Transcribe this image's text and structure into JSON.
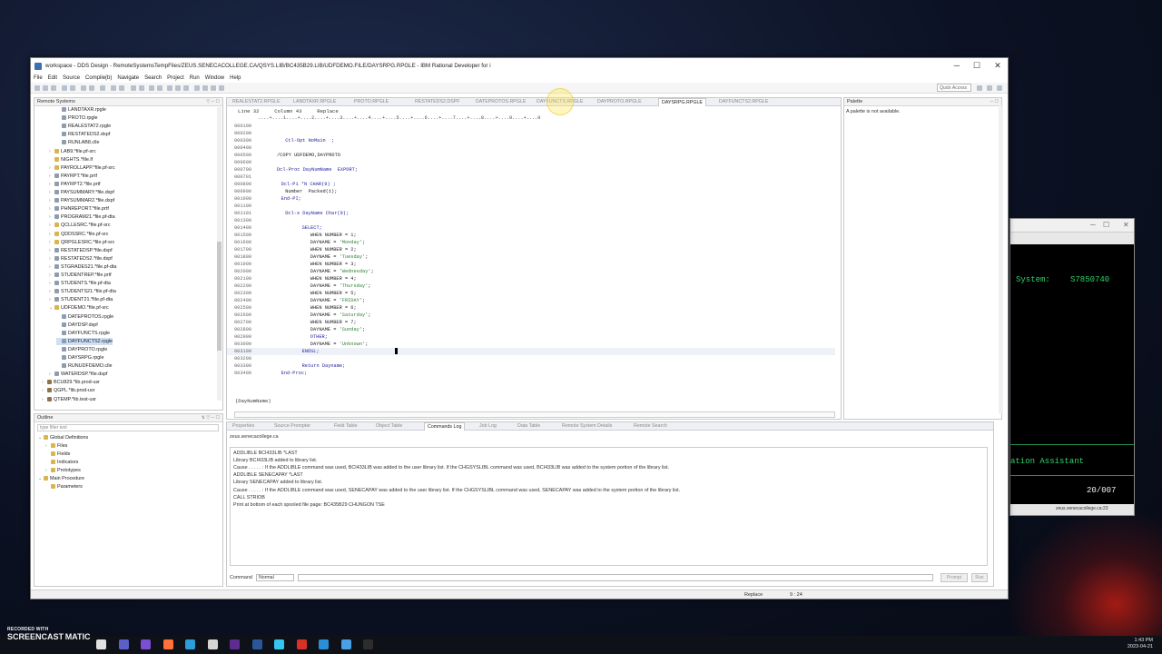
{
  "window": {
    "title": "workspace - DDS Design - RemoteSystemsTempFiles/ZEUS.SENECACOLLEGE.CA/QSYS.LIB/BC435B29.LIB/UDFDEMO.FILE/DAYSRPG.RPGLE - IBM Rational Developer for i",
    "min": "─",
    "max": "☐",
    "close": "✕"
  },
  "menu": [
    "File",
    "Edit",
    "Source",
    "Compile(b)",
    "Navigate",
    "Search",
    "Project",
    "Run",
    "Window",
    "Help"
  ],
  "quick_access": "Quick Access",
  "remote_systems": {
    "title": "Remote Systems",
    "items": [
      {
        "label": "LANDTAXR.rpgle",
        "indent": 3,
        "kind": "file"
      },
      {
        "label": "PROTO.rpgle",
        "indent": 3,
        "kind": "file"
      },
      {
        "label": "REALESTAT2.rpgle",
        "indent": 3,
        "kind": "file"
      },
      {
        "label": "RESTATEDS2.dspf",
        "indent": 3,
        "kind": "file"
      },
      {
        "label": "RUNLAB8.clle",
        "indent": 3,
        "kind": "file"
      },
      {
        "label": "LAB9.*file.pf-src",
        "indent": 2,
        "kind": "folder",
        "tw": "›"
      },
      {
        "label": "NIGHTS.*file.lf",
        "indent": 2,
        "kind": "folder",
        "tw": ""
      },
      {
        "label": "PAYROLLAPP.*file.pf-src",
        "indent": 2,
        "kind": "folder",
        "tw": "›"
      },
      {
        "label": "PAYRPT.*file.prtf",
        "indent": 2,
        "kind": "file",
        "tw": "›"
      },
      {
        "label": "PAYRPT2.*file.prtf",
        "indent": 2,
        "kind": "file",
        "tw": "›"
      },
      {
        "label": "PAYSUMMARY.*file.dspf",
        "indent": 2,
        "kind": "file",
        "tw": "›"
      },
      {
        "label": "PAYSUMMAR2.*file.dspf",
        "indent": 2,
        "kind": "file",
        "tw": "›"
      },
      {
        "label": "PHNREPORT.*file.prtf",
        "indent": 2,
        "kind": "file",
        "tw": "›"
      },
      {
        "label": "PROGRAM21.*file.pf-dta",
        "indent": 2,
        "kind": "file",
        "tw": "›"
      },
      {
        "label": "QCLLESRC.*file.pf-src",
        "indent": 2,
        "kind": "folder",
        "tw": "›"
      },
      {
        "label": "QDDSSRC.*file.pf-src",
        "indent": 2,
        "kind": "folder",
        "tw": "›"
      },
      {
        "label": "QRPGLESRC.*file.pf-src",
        "indent": 2,
        "kind": "folder",
        "tw": "›"
      },
      {
        "label": "RESTATEDSP.*file.dspf",
        "indent": 2,
        "kind": "file",
        "tw": "›"
      },
      {
        "label": "RESTATEDS2.*file.dspf",
        "indent": 2,
        "kind": "file",
        "tw": "›"
      },
      {
        "label": "STGRADES21.*file.pf-dta",
        "indent": 2,
        "kind": "file",
        "tw": "›"
      },
      {
        "label": "STUDENTREP.*file.prtf",
        "indent": 2,
        "kind": "file",
        "tw": "›"
      },
      {
        "label": "STUDENTS.*file.pf-dta",
        "indent": 2,
        "kind": "file",
        "tw": "›"
      },
      {
        "label": "STUDENTS21.*file.pf-dta",
        "indent": 2,
        "kind": "file",
        "tw": "›"
      },
      {
        "label": "STUDENT21.*file.pf-dta",
        "indent": 2,
        "kind": "file",
        "tw": "›"
      },
      {
        "label": "UDFDEMO.*file.pf-src",
        "indent": 2,
        "kind": "folder",
        "tw": "⌄"
      },
      {
        "label": "DATEPROTOS.rpgle",
        "indent": 3,
        "kind": "file"
      },
      {
        "label": "DAYDSP.dspf",
        "indent": 3,
        "kind": "file"
      },
      {
        "label": "DAYFUNCTS.rpgle",
        "indent": 3,
        "kind": "file"
      },
      {
        "label": "DAYFUNCTS2.rpgle",
        "indent": 3,
        "kind": "file",
        "selected": true
      },
      {
        "label": "DAYPROTO.rpgle",
        "indent": 3,
        "kind": "file"
      },
      {
        "label": "DAYSRPG.rpgle",
        "indent": 3,
        "kind": "file"
      },
      {
        "label": "RUNUDFDEMO.clle",
        "indent": 3,
        "kind": "file"
      },
      {
        "label": "WATERDSP.*file.dspf",
        "indent": 2,
        "kind": "file",
        "tw": "›"
      },
      {
        "label": "BCU829.*lib.prod-usr",
        "indent": 1,
        "kind": "lib",
        "tw": "›"
      },
      {
        "label": "QGPL.*lib.prod-usr",
        "indent": 1,
        "kind": "lib",
        "tw": "›"
      },
      {
        "label": "QTEMP.*lib.test-usr",
        "indent": 1,
        "kind": "lib",
        "tw": "›"
      }
    ]
  },
  "editor": {
    "tabs": [
      {
        "label": "REALESTAT2.RPGLE",
        "active": false
      },
      {
        "label": "LANDTAXR.RPGLE",
        "active": false
      },
      {
        "label": "PROTO.RPGLE",
        "active": false
      },
      {
        "label": "RESTATEDS2.DSPF",
        "active": false
      },
      {
        "label": "DATEPROTOS.RPGLE",
        "active": false
      },
      {
        "label": "DAYFUNCTS.RPGLE",
        "active": false
      },
      {
        "label": "DAYPROTO.RPGLE",
        "active": false
      },
      {
        "label": "DAYSRPG.RPGLE",
        "active": true
      },
      {
        "label": "DAYFUNCTS2.RPGLE",
        "active": false
      }
    ],
    "status": "Line 32     Column 43     Replace",
    "ruler": "....+....1....+....2....+....3....+....4....+....5....+....6....+....7....+....8....+....9....+....0",
    "lines": [
      {
        "n": "000100",
        "t": ""
      },
      {
        "n": "000200",
        "t": ""
      },
      {
        "n": "000300",
        "t": "Ctl-Opt NoMain  ;",
        "x": 2
      },
      {
        "n": "000400",
        "t": ""
      },
      {
        "n": "000500",
        "t": "/COPY UDFDEMO,DAYPROTO",
        "x": 0
      },
      {
        "n": "000600",
        "t": ""
      },
      {
        "n": "000700",
        "t": "Dcl-Proc DayNumName  EXPORT;",
        "x": 0
      },
      {
        "n": "000701",
        "t": ""
      },
      {
        "n": "000800",
        "t": "Dcl-Pi *N CHAR(9) ;",
        "x": 1
      },
      {
        "n": "000900",
        "t": "Number  Packed(1);",
        "x": 2
      },
      {
        "n": "001000",
        "t": "End-PI;",
        "x": 1
      },
      {
        "n": "001100",
        "t": ""
      },
      {
        "n": "001101",
        "t": "Dcl-s DayName Char(9);",
        "x": 2
      },
      {
        "n": "001300",
        "t": ""
      },
      {
        "n": "001400",
        "t": "SELECT;",
        "x": 6
      },
      {
        "n": "001500",
        "t": "WHEN NUMBER = 1;",
        "x": 8
      },
      {
        "n": "001600",
        "t": "DAYNAME = 'Monday';",
        "x": 8
      },
      {
        "n": "001700",
        "t": "WHEN NUMBER = 2;",
        "x": 8
      },
      {
        "n": "001800",
        "t": "DAYNAME = 'Tuesday';",
        "x": 8
      },
      {
        "n": "001900",
        "t": "WHEN NUMBER = 3;",
        "x": 8
      },
      {
        "n": "002000",
        "t": "DAYNAME = 'Wednesday';",
        "x": 8
      },
      {
        "n": "002100",
        "t": "WHEN NUMBER = 4;",
        "x": 8
      },
      {
        "n": "002200",
        "t": "DAYNAME = 'Thursday';",
        "x": 8
      },
      {
        "n": "002300",
        "t": "WHEN NUMBER = 5;",
        "x": 8
      },
      {
        "n": "002400",
        "t": "DAYNAME = 'FRIDAY';",
        "x": 8
      },
      {
        "n": "002500",
        "t": "WHEN NUMBER = 6;",
        "x": 8
      },
      {
        "n": "002600",
        "t": "DAYNAME = 'Saturday';",
        "x": 8
      },
      {
        "n": "002700",
        "t": "WHEN NUMBER = 7;",
        "x": 8
      },
      {
        "n": "002800",
        "t": "DAYNAME = 'Sunday';",
        "x": 8
      },
      {
        "n": "002900",
        "t": "OTHER;",
        "x": 8
      },
      {
        "n": "003000",
        "t": "DAYNAME = 'Unknown';",
        "x": 8
      },
      {
        "n": "003100",
        "t": "ENDSL;",
        "x": 6,
        "current": true
      },
      {
        "n": "003200",
        "t": ""
      },
      {
        "n": "003300",
        "t": "Return Dayname;",
        "x": 6
      },
      {
        "n": "003400",
        "t": "End-Proc;",
        "x": 1
      }
    ],
    "proto_label": "(DayNumName)"
  },
  "palette": {
    "title": "Palette",
    "message": "A palette is not available."
  },
  "outline": {
    "title": "Outline",
    "filter_placeholder": "type filter text",
    "items": [
      {
        "label": "Global Definitions",
        "indent": 0,
        "tw": "⌄"
      },
      {
        "label": "Files",
        "indent": 1,
        "tw": "›"
      },
      {
        "label": "Fields",
        "indent": 1,
        "tw": ""
      },
      {
        "label": "Indicators",
        "indent": 1,
        "tw": ""
      },
      {
        "label": "Prototypes",
        "indent": 1,
        "tw": "›"
      },
      {
        "label": "Main Procedure",
        "indent": 0,
        "tw": "⌄"
      },
      {
        "label": "Parameters",
        "indent": 1,
        "tw": ""
      }
    ]
  },
  "console": {
    "tabs": [
      {
        "label": "Properties",
        "active": false
      },
      {
        "label": "Source Prompter",
        "active": false
      },
      {
        "label": "Field Table",
        "active": false
      },
      {
        "label": "Object Table",
        "active": false
      },
      {
        "label": "Commands Log",
        "active": true
      },
      {
        "label": "Job Log",
        "active": false
      },
      {
        "label": "Data Table",
        "active": false
      },
      {
        "label": "Remote System Details",
        "active": false
      },
      {
        "label": "Remote Search",
        "active": false
      }
    ],
    "host": "zeus.senecacollege.ca",
    "lines": [
      "ADDLIBLE BCI433LIB *LAST",
      "Library BCI433LIB added to library list.",
      "Cause . . . . . :   If the ADDLIBLE command was used, BCI433LIB was added to the user library list.  If the CHGSYSLIBL command was used, BCI433LIB was added to the system portion of the library list.",
      "ADDLIBLE SENECAPAY *LAST",
      "Library SENECAPAY added to library list.",
      "Cause . . . . . :   If the ADDLIBLE command was used, SENECAPAY was added to the user library list.  If the CHGSYSLIBL command was used, SENECAPAY was added to the system portion of the library list.",
      "CALL STRIOB",
      "Print at bottom of each spooled file page: BC435B29 CHUNGON TSE"
    ],
    "command_label": "Command",
    "command_mode": "Normal",
    "prompt_btn": "Prompt",
    "run_btn": "Run"
  },
  "statusbar": {
    "mode": "Replace",
    "pos": "9 : 24"
  },
  "terminal": {
    "system_label": "System:",
    "system_value": "S7850740",
    "assistant": "ation Assistant",
    "counter": "20/007",
    "status": "zeus.senecacollege.ca:23"
  },
  "taskbar": {
    "time": "1:43 PM",
    "date": "2023-04-21",
    "icon_colors": [
      "#e1e1e1",
      "#5b5fc7",
      "#7a4fd1",
      "#ff7139",
      "#2d9cdb",
      "#d4d4d4",
      "#5e2c91",
      "#2b579a",
      "#36c5f0",
      "#d73228",
      "#2b8fd6",
      "#4aa0e6",
      "#2d2d2d"
    ]
  },
  "watermark": {
    "line1": "RECORDED WITH",
    "line2": "SCREENCAST",
    "line3": "MATIC"
  }
}
